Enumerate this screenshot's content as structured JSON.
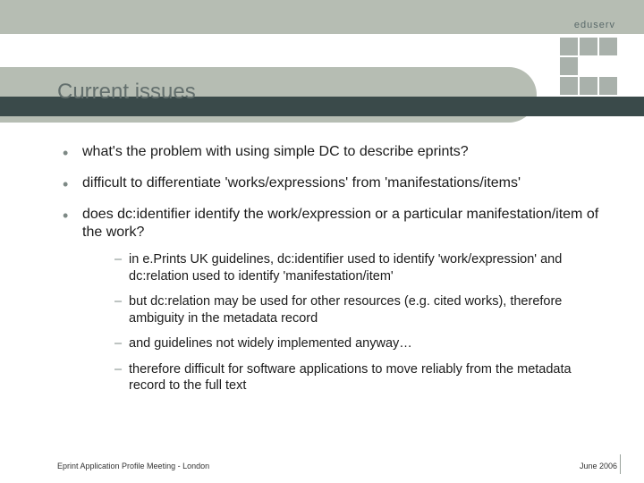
{
  "brand": "eduserv",
  "title": "Current issues",
  "bullets": [
    {
      "text": "what's the problem with using simple DC to describe eprints?"
    },
    {
      "text": "difficult to differentiate 'works/expressions' from 'manifestations/items'"
    },
    {
      "text": "does dc:identifier identify the work/expression or a particular manifestation/item of the work?",
      "sub": [
        "in e.Prints UK guidelines, dc:identifier used to identify 'work/expression' and dc:relation used to identify 'manifestation/item'",
        "but dc:relation may be used for other resources (e.g. cited works), therefore ambiguity in the metadata record",
        "and guidelines not widely implemented anyway…",
        "therefore difficult for software applications to move reliably from the metadata record to the full text"
      ]
    }
  ],
  "footer": {
    "left": "Eprint Application Profile Meeting - London",
    "right": "June 2006"
  }
}
